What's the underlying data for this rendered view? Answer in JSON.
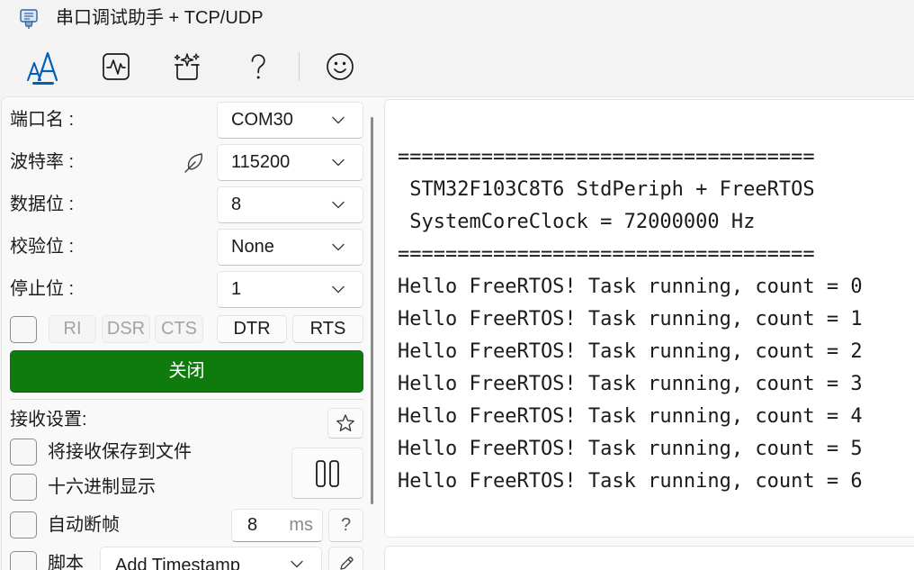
{
  "window": {
    "title": "串口调试助手 + TCP/UDP",
    "app_icon": "serial-port-icon"
  },
  "toolbar": {
    "items": [
      {
        "icon": "text-font-icon",
        "selected": true
      },
      {
        "icon": "waveform-icon",
        "selected": false
      },
      {
        "icon": "sparkle-icon",
        "selected": false
      },
      {
        "icon": "question-icon",
        "selected": false
      },
      {
        "icon": "smiley-icon",
        "selected": false
      }
    ]
  },
  "serial_settings": {
    "port": {
      "label": "端口名 :",
      "value": "COM30"
    },
    "baud_rate": {
      "label": "波特率 :",
      "value": "115200",
      "icon": "feather-icon"
    },
    "data_bits": {
      "label": "数据位 :",
      "value": "8"
    },
    "parity": {
      "label": "校验位 :",
      "value": "None"
    },
    "stop_bits": {
      "label": "停止位 :",
      "value": "1"
    },
    "signals_checkbox_checked": false,
    "signals": [
      {
        "label": "RI",
        "enabled": false
      },
      {
        "label": "DSR",
        "enabled": false
      },
      {
        "label": "CTS",
        "enabled": false
      },
      {
        "label": "DTR",
        "enabled": true
      },
      {
        "label": "RTS",
        "enabled": true
      }
    ],
    "open_close_button": "关闭"
  },
  "receive_settings": {
    "title": "接收设置:",
    "save_to_file": {
      "label": "将接收保存到文件",
      "checked": false
    },
    "hex_display": {
      "label": "十六进制显示",
      "checked": false
    },
    "auto_frame": {
      "label": "自动断帧",
      "checked": false,
      "value": "8",
      "unit": "ms"
    },
    "help_button": "?",
    "script": {
      "label": "脚本",
      "checked": false,
      "value": "Add Timestamp"
    }
  },
  "receive_view": {
    "lines": [
      "===================================",
      " STM32F103C8T6 StdPeriph + FreeRTOS",
      " SystemCoreClock = 72000000 Hz",
      "===================================",
      "Hello FreeRTOS! Task running, count = 0",
      "Hello FreeRTOS! Task running, count = 1",
      "Hello FreeRTOS! Task running, count = 2",
      "Hello FreeRTOS! Task running, count = 3",
      "Hello FreeRTOS! Task running, count = 4",
      "Hello FreeRTOS! Task running, count = 5",
      "Hello FreeRTOS! Task running, count = 6"
    ]
  },
  "colors": {
    "accent": "#005fb8",
    "close_button": "#0f7b0f",
    "window_bg": "#f3f3f3",
    "pane_bg": "#f9f9f9",
    "text": "#1b1b1b",
    "disabled_text": "#a3a3a3"
  }
}
